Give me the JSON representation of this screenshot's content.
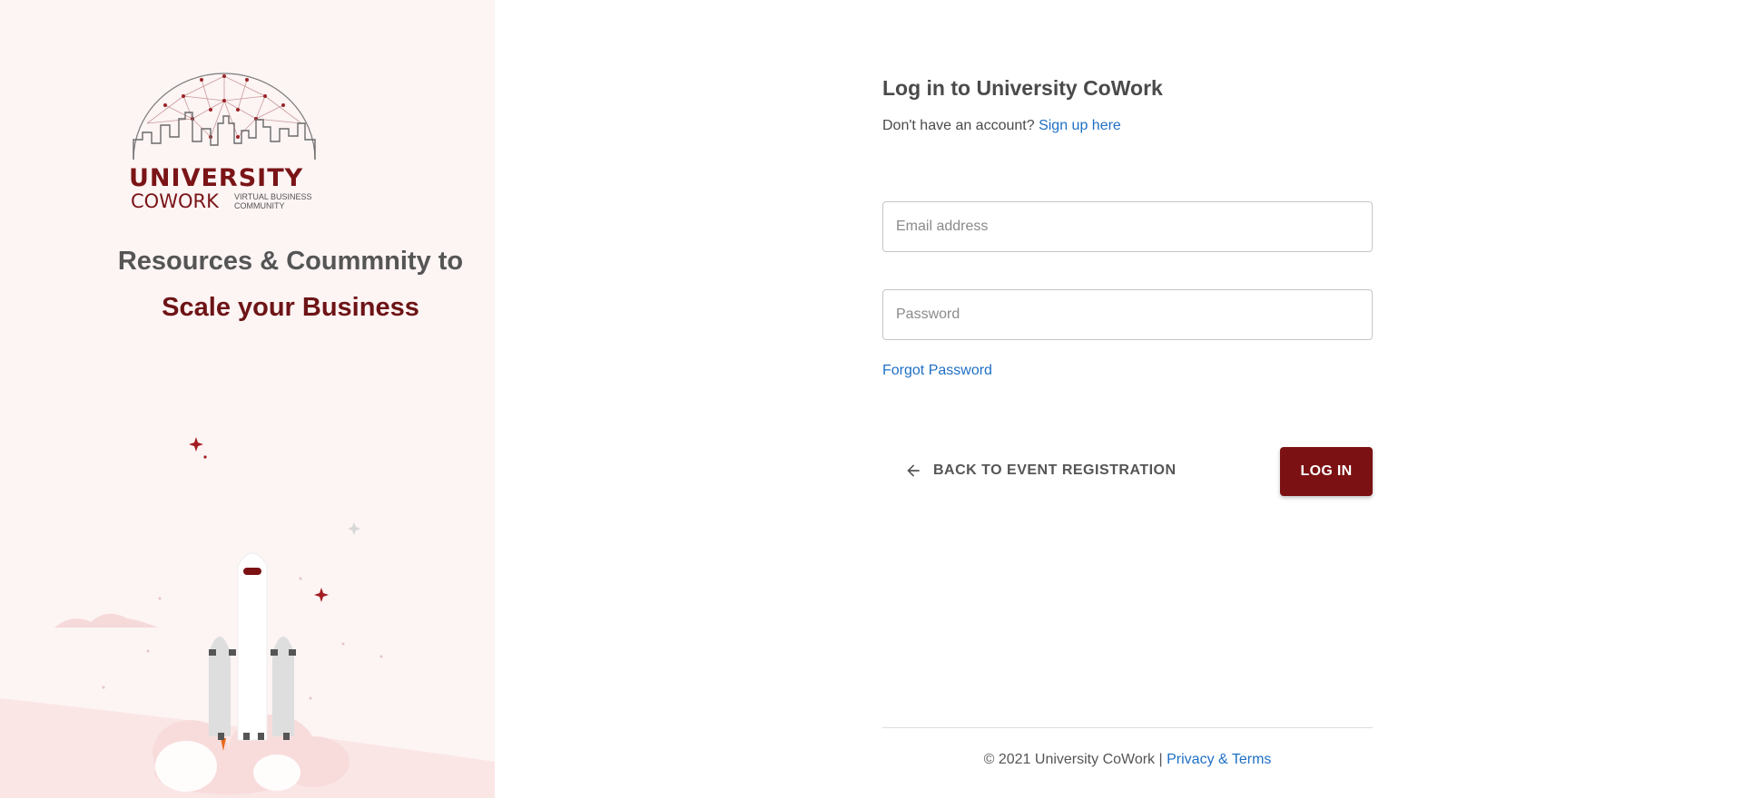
{
  "brand": {
    "logo_word_1": "UNIVERSITY",
    "logo_word_2": "COWORK",
    "logo_tagline": "VIRTUAL BUSINESS COMMUNITY",
    "tagline_line_1": "Resources & Coummnity to",
    "tagline_line_2": "Scale your Business"
  },
  "login": {
    "title": "Log in to University CoWork",
    "no_account_text": "Don't have an account?",
    "signup_link": "Sign up here",
    "email_placeholder": "Email address",
    "email_value": "",
    "password_placeholder": "Password",
    "password_value": "",
    "forgot_password": "Forgot Password",
    "back_button": "BACK TO EVENT REGISTRATION",
    "back_icon": "arrow-left-icon",
    "login_button": "LOG IN"
  },
  "footer": {
    "copyright": "© 2021 University CoWork |",
    "privacy_link": "Privacy & Terms"
  },
  "colors": {
    "brand_maroon": "#7b1113",
    "link_blue": "#1e6fc4",
    "panel_bg": "#fdf4f4",
    "text_gray": "#4a4a4a"
  }
}
